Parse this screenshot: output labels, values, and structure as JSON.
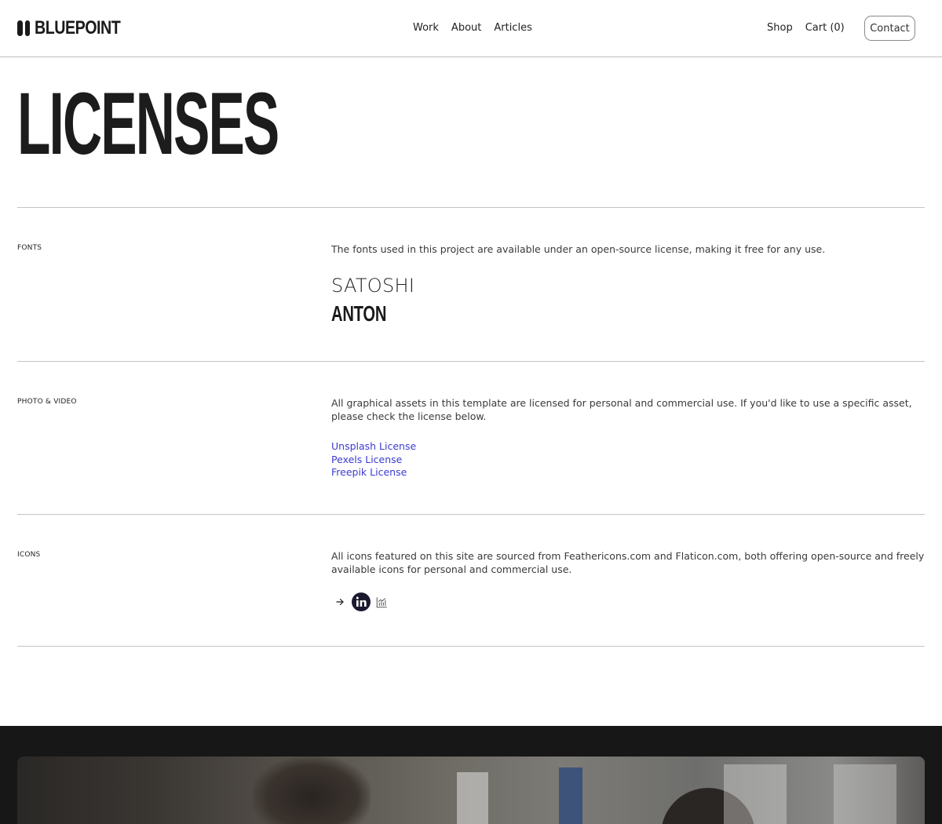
{
  "header": {
    "brand": "BLUEPOINT",
    "nav_center": [
      "Work",
      "About",
      "Articles"
    ],
    "nav_right": [
      "Shop",
      "Cart (0)"
    ],
    "contact_label": "Contact"
  },
  "page": {
    "title": "LICENSES"
  },
  "sections": {
    "fonts": {
      "label": "FONTS",
      "text": "The fonts used in this project are available under an open-source license, making it free for any use.",
      "font_1": "SATOSHI",
      "font_2": "ANTON"
    },
    "photo_video": {
      "label": "PHOTO & VIDEO",
      "text": "All graphical assets in this template are licensed for personal and commercial use. If you'd like to use a specific asset, please check the license below.",
      "links": [
        "Unsplash License",
        "Pexels License",
        "Freepik License"
      ]
    },
    "icons": {
      "label": "ICONS",
      "text": "All icons featured on this site are sourced from Feathericons.com and Flaticon.com, both offering open-source and freely available icons for personal and commercial use.",
      "icon_names": [
        "arrow-right-icon",
        "linkedin-icon",
        "chart-icon"
      ]
    }
  },
  "colors": {
    "link": "#3b3bd1",
    "footer_bg": "#171717",
    "text": "#1f1f1f"
  }
}
